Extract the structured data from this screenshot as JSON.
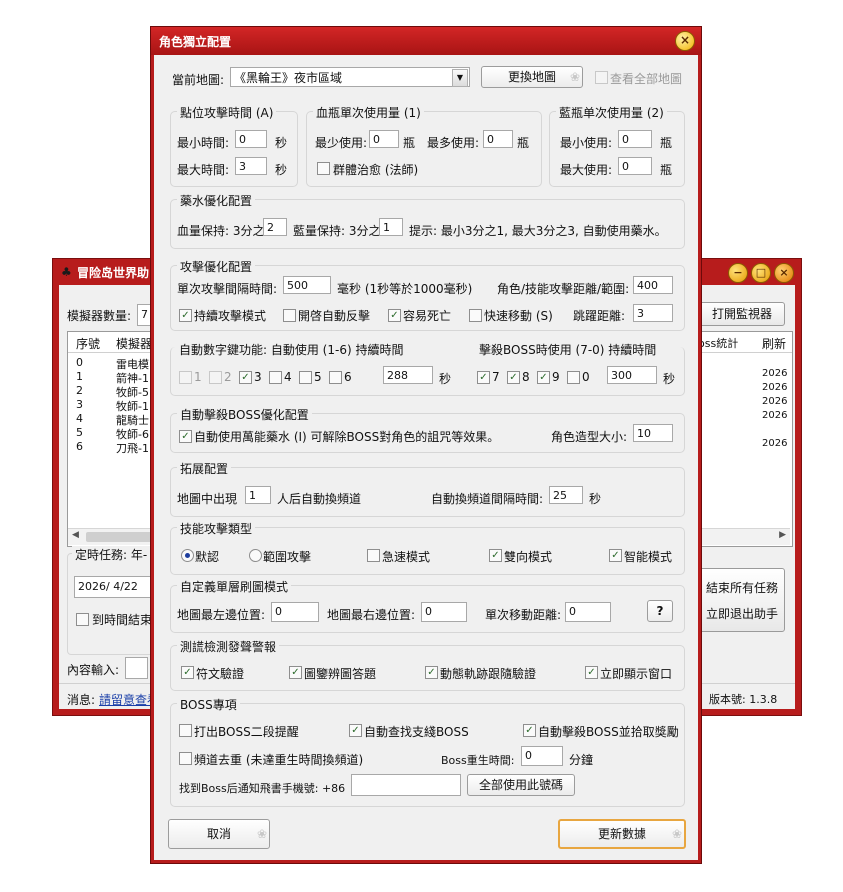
{
  "bg_window": {
    "title": "冒险岛世界助",
    "emulator_count_label": "模擬器數量:",
    "emulator_count_value": "7",
    "open_monitor_btn": "打開監視器",
    "list_headers": [
      "序號",
      "模擬器"
    ],
    "list_rows": [
      {
        "no": "0",
        "name": "雷电模"
      },
      {
        "no": "1",
        "name": "箭神-1"
      },
      {
        "no": "2",
        "name": "牧師-5"
      },
      {
        "no": "3",
        "name": "牧師-1"
      },
      {
        "no": "4",
        "name": "龍騎士"
      },
      {
        "no": "5",
        "name": "牧師-6"
      },
      {
        "no": "6",
        "name": "刀飛-1"
      }
    ],
    "right_headers": [
      "oss統計",
      "刷新"
    ],
    "right_values": [
      "2026",
      "2026",
      "2026",
      "2026",
      "2026"
    ],
    "timer_label": "定時任務: 年-",
    "timer_date": "2026/  4/22",
    "end_at_time": "到時間結束",
    "content_input_label": "內容輸入:",
    "end_all_btn": "結束所有任務",
    "exit_btn": "立即退出助手",
    "message_label": "消息:",
    "message_link": "請留意查看",
    "version_label": "版本號: 1.3.8"
  },
  "dialog": {
    "title": "角色獨立配置",
    "close_icon": "×",
    "current_map_label": "當前地圖:",
    "current_map_value": "《黑輪王》夜市區域",
    "change_map_btn": "更換地圖",
    "view_all_maps": "查看全部地圖",
    "attack_time": {
      "title": "點位攻擊時間 (A)",
      "min_label": "最小時間:",
      "min_value": "0",
      "min_unit": "秒",
      "max_label": "最大時間:",
      "max_value": "3",
      "max_unit": "秒"
    },
    "hp_potion": {
      "title": "血瓶單次使用量 (1)",
      "min_label": "最少使用:",
      "min_value": "0",
      "min_unit": "瓶",
      "max_label": "最多使用:",
      "max_value": "0",
      "max_unit": "瓶",
      "group_heal": "群體治愈 (法師)"
    },
    "mp_potion": {
      "title": "藍瓶单次使用量 (2)",
      "min_label": "最小使用:",
      "min_value": "0",
      "min_unit": "瓶",
      "max_label": "最大使用:",
      "max_value": "0",
      "max_unit": "瓶"
    },
    "potion_opt": {
      "title": "藥水優化配置",
      "hp_label": "血量保持: 3分之",
      "hp_value": "2",
      "mp_label": "藍量保持: 3分之",
      "mp_value": "1",
      "hint": "提示: 最小3分之1, 最大3分之3, 自動使用藥水。"
    },
    "attack_opt": {
      "title": "攻擊優化配置",
      "interval_label": "單次攻擊間隔時間:",
      "interval_value": "500",
      "interval_note": "毫秒 (1秒等於1000毫秒)",
      "range_label": "角色/技能攻擊距離/範圍:",
      "range_value": "400",
      "continuous": "持續攻擊模式",
      "auto_counter": "開啓自動反擊",
      "easy_die": "容易死亡",
      "fast_move": "快速移動 (S)",
      "jump_label": "跳躍距離:",
      "jump_value": "3"
    },
    "numkeys": {
      "auto_label": "自動數字鍵功能: 自動使用 (1-6) 持續時間",
      "boss_label": "擊殺BOSS時使用 (7-0) 持續時間",
      "keys_a": [
        "1",
        "2",
        "3",
        "4",
        "5",
        "6"
      ],
      "duration_a": "288",
      "unit_a": "秒",
      "keys_b": [
        "7",
        "8",
        "9",
        "0"
      ],
      "duration_b": "300",
      "unit_b": "秒"
    },
    "boss_opt": {
      "title": "自動擊殺BOSS優化配置",
      "universal_potion": "自動使用萬能藥水 (I) 可解除BOSS對角色的詛咒等效果。",
      "model_size_label": "角色造型大小:",
      "model_size_value": "10"
    },
    "expand": {
      "title": "拓展配置",
      "appear_label": "地圖中出現",
      "appear_value": "1",
      "appear_suffix": "人后自動換頻道",
      "interval_label": "自動換頻道間隔時間:",
      "interval_value": "25",
      "interval_unit": "秒"
    },
    "skill_type": {
      "title": "技能攻擊類型",
      "default": "默認",
      "range": "範圍攻擊",
      "rapid": "急速模式",
      "two_way": "雙向模式",
      "smart": "智能模式"
    },
    "single_layer": {
      "title": "自定義單層刷圖模式",
      "left_label": "地圖最左邊位置:",
      "left_value": "0",
      "right_label": "地圖最右邊位置:",
      "right_value": "0",
      "move_label": "單次移動距離:",
      "move_value": "0",
      "help_btn": "?"
    },
    "detect": {
      "title": "測謊檢測發聲警報",
      "rune": "符文驗證",
      "image": "圖鑒辨圖答題",
      "trace": "動態軌跡跟隨驗證",
      "show_window": "立即顯示窗口"
    },
    "boss": {
      "title": "BOSS專項",
      "phase2": "打出BOSS二段提醒",
      "auto_find": "自動查找支綫BOSS",
      "auto_kill": "自動擊殺BOSS並拾取獎勵",
      "dedupe": "頻道去重 (未達重生時間換頻道)",
      "respawn_label": "Boss重生時間:",
      "respawn_value": "0",
      "respawn_unit": "分鐘",
      "notify_label": "找到Boss后通知飛書手機號: +86",
      "notify_value": "",
      "use_all_btn": "全部使用此號碼"
    },
    "cancel_btn": "取消",
    "update_btn": "更新數據"
  }
}
